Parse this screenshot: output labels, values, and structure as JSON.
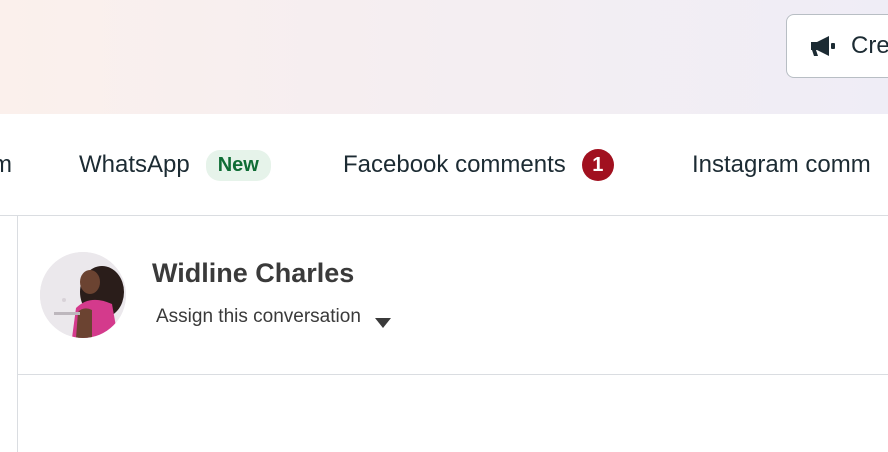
{
  "header": {
    "create_button_label": "Cre"
  },
  "tabs": [
    {
      "label": "m"
    },
    {
      "label": "WhatsApp",
      "badge": "New"
    },
    {
      "label": "Facebook comments",
      "count": "1"
    },
    {
      "label": "Instagram comm"
    }
  ],
  "conversation": {
    "contact_name": "Widline Charles",
    "assign_label": "Assign this conversation"
  },
  "colors": {
    "badge_new_bg": "#e6f3ea",
    "badge_new_text": "#0f6d35",
    "count_badge": "#a1101f"
  }
}
